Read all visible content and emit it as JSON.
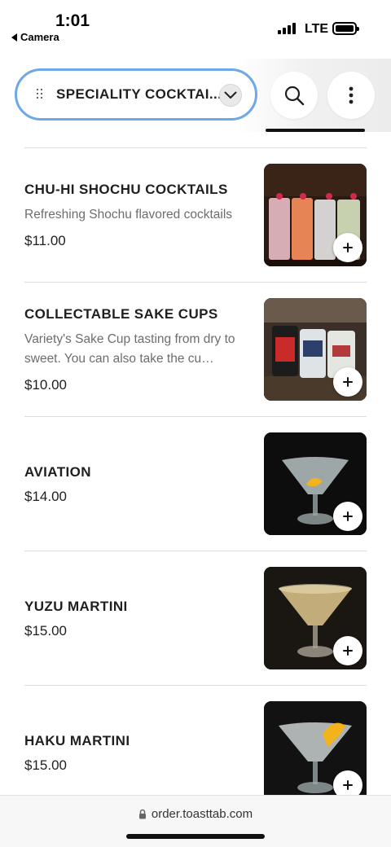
{
  "status_bar": {
    "time": "1:01",
    "back_app": "Camera",
    "network": "LTE"
  },
  "header": {
    "category": "SPECIALITY COCKTAI...",
    "icons": {
      "drag": "drag-handle-icon",
      "chevron": "chevron-down-icon",
      "search": "search-icon",
      "more": "more-vertical-icon"
    },
    "accent_color": "#6ea8e6"
  },
  "menu_items": [
    {
      "name": "CHU-HI SHOCHU COCKTAILS",
      "description": "Refreshing Shochu flavored cocktails",
      "price": "$11.00"
    },
    {
      "name": "COLLECTABLE SAKE CUPS",
      "description": "Variety's Sake Cup tasting from dry to sweet. You can also take the cu…",
      "price": "$10.00"
    },
    {
      "name": "AVIATION",
      "description": "",
      "price": "$14.00"
    },
    {
      "name": "YUZU MARTINI",
      "description": "",
      "price": "$15.00"
    },
    {
      "name": "HAKU MARTINI",
      "description": "",
      "price": "$15.00"
    }
  ],
  "add_icon": "plus-icon",
  "browser": {
    "url": "order.toasttab.com",
    "lock_icon": "lock-icon"
  }
}
